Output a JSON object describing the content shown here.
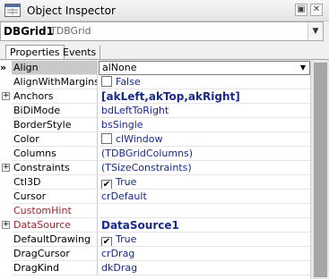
{
  "window": {
    "title": "Object Inspector",
    "pin_glyph": "▣",
    "close_glyph": "✕"
  },
  "component": {
    "name": "DBGrid1",
    "type": "TDBGrid",
    "drop_glyph": "▼"
  },
  "tabs": [
    {
      "label": "Properties"
    },
    {
      "label": "Events"
    }
  ],
  "grid": {
    "current_marker": "»",
    "rows": [
      {
        "name": "Align",
        "value": "alNone",
        "selected": true
      },
      {
        "name": "AlignWithMargins",
        "value": "False"
      },
      {
        "name": "Anchors",
        "value": "[akLeft,akTop,akRight]"
      },
      {
        "name": "BiDiMode",
        "value": "bdLeftToRight"
      },
      {
        "name": "BorderStyle",
        "value": "bsSingle"
      },
      {
        "name": "Color",
        "value": "clWindow"
      },
      {
        "name": "Columns",
        "value": "(TDBGridColumns)"
      },
      {
        "name": "Constraints",
        "value": "(TSizeConstraints)"
      },
      {
        "name": "Ctl3D",
        "value": "True"
      },
      {
        "name": "Cursor",
        "value": "crDefault"
      },
      {
        "name": "CustomHint",
        "value": ""
      },
      {
        "name": "DataSource",
        "value": "DataSource1"
      },
      {
        "name": "DefaultDrawing",
        "value": "True"
      },
      {
        "name": "DragCursor",
        "value": "crDrag"
      },
      {
        "name": "DragKind",
        "value": "dkDrag"
      }
    ]
  },
  "glyphs": {
    "expand": "+",
    "check": "✔",
    "combo_drop": "▼"
  },
  "colors": {
    "value_text": "#1a2a8a",
    "event_name": "#a0242c",
    "selected_row": "#c9c9c9"
  }
}
